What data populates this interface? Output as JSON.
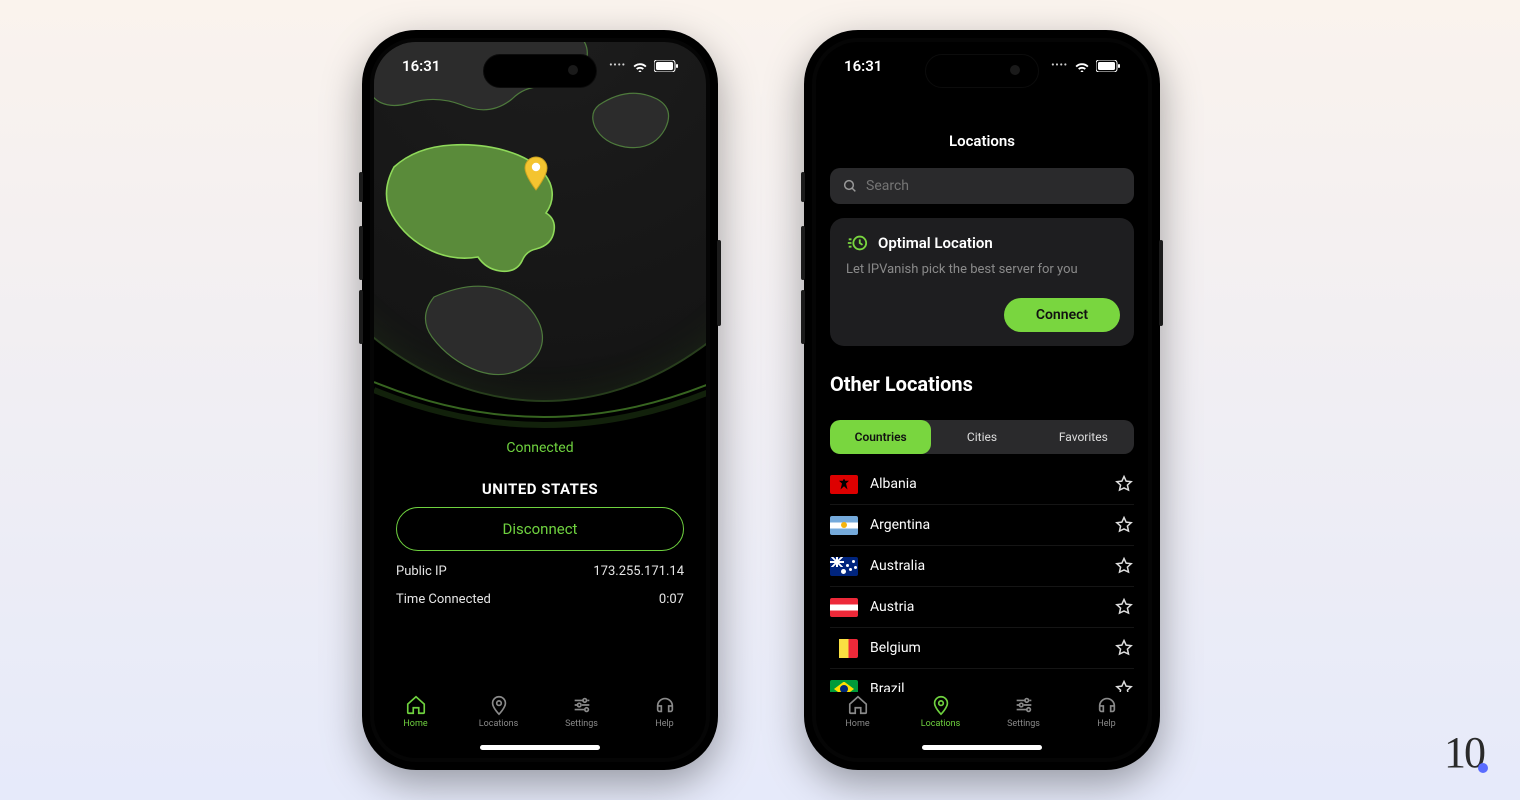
{
  "status": {
    "time": "16:31"
  },
  "home": {
    "status": "Connected",
    "country": "UNITED STATES",
    "disconnect": "Disconnect",
    "ip_label": "Public IP",
    "ip_value": "173.255.171.14",
    "time_label": "Time Connected",
    "time_value": "0:07"
  },
  "locations": {
    "title": "Locations",
    "search_placeholder": "Search",
    "optimal": {
      "title": "Optimal Location",
      "subtitle": "Let IPVanish pick the best server for you",
      "connect": "Connect"
    },
    "other_heading": "Other Locations",
    "segments": [
      "Countries",
      "Cities",
      "Favorites"
    ],
    "countries": [
      "Albania",
      "Argentina",
      "Australia",
      "Austria",
      "Belgium",
      "Brazil"
    ]
  },
  "tabs": [
    "Home",
    "Locations",
    "Settings",
    "Help"
  ],
  "watermark": "10"
}
